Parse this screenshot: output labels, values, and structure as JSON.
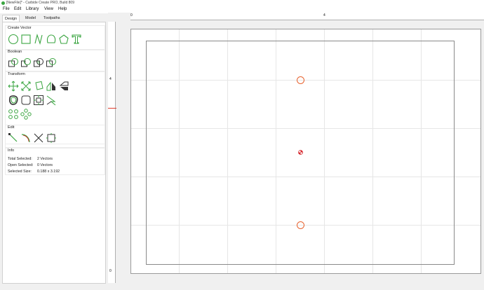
{
  "window": {
    "title": "[NewFile]* - Carbide Create PRO, Build 809"
  },
  "menu": [
    "File",
    "Edit",
    "Library",
    "View",
    "Help"
  ],
  "tabs": [
    "Design",
    "Model",
    "Toolpaths"
  ],
  "sidebar": {
    "create_vector": {
      "title": "Create Vector",
      "icons": [
        "circle-icon",
        "rectangle-icon",
        "curve-icon",
        "polygon-icon",
        "pentagon-icon",
        "text-icon"
      ]
    },
    "boolean": {
      "title": "Boolean",
      "icons": [
        "union-icon",
        "subtract-icon",
        "intersect-icon",
        "combine-icon"
      ]
    },
    "transform": {
      "title": "Transform",
      "icons": [
        "move-icon",
        "scale-icon",
        "rotate-icon",
        "mirror-horizontal-icon",
        "mirror-vertical-icon",
        "offset-icon",
        "fillet-icon",
        "align-icon",
        "join-icon",
        "array-icon",
        "circular-array-icon"
      ]
    },
    "edit": {
      "title": "Edit",
      "icons": [
        "node-edit-icon",
        "trim-icon",
        "cut-icon",
        "bounding-box-icon"
      ]
    },
    "info": {
      "title": "Info",
      "rows": [
        {
          "label": "Total Selected:",
          "value": "2 Vectors"
        },
        {
          "label": "Open Selected:",
          "value": "0 Vectors"
        },
        {
          "label": "Selected Size:",
          "value": "0.188 x 3.192"
        }
      ]
    }
  },
  "rulers": {
    "horizontal": [
      "0",
      "4"
    ],
    "vertical": [
      "4",
      "0"
    ]
  },
  "colors": {
    "accent": "#3aa540",
    "selection": "#e8632f",
    "origin": "#d6262c"
  }
}
